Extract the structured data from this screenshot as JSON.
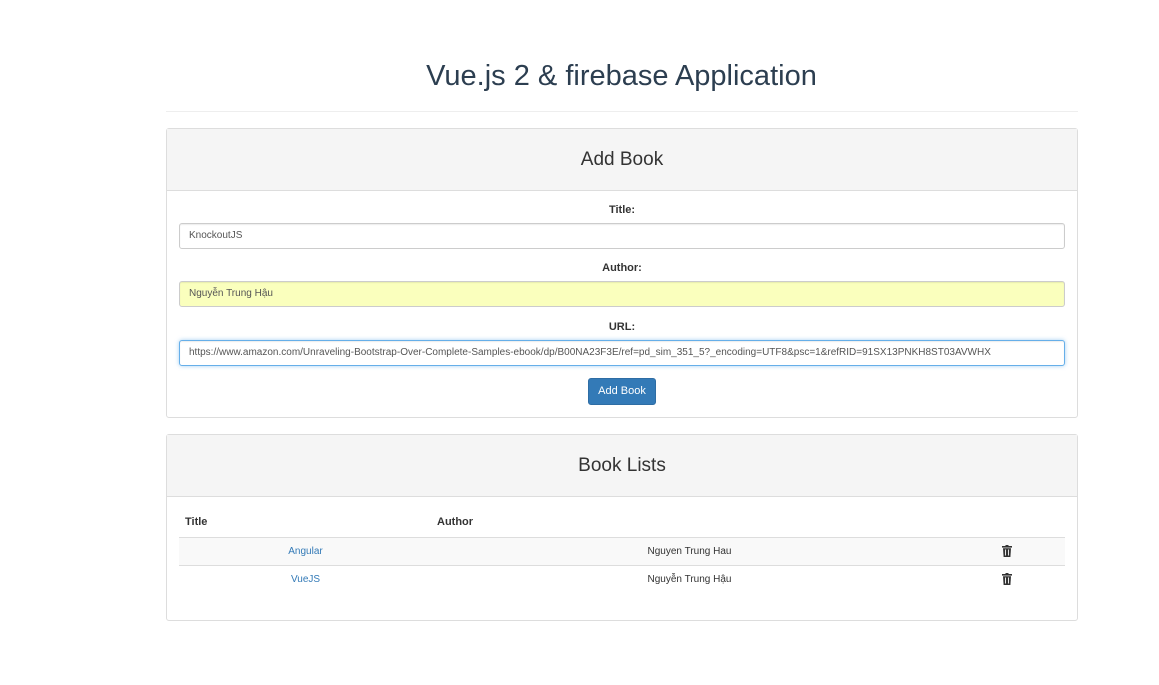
{
  "app": {
    "title": "Vue.js 2 & firebase Application"
  },
  "add_book": {
    "heading": "Add Book",
    "title_label": "Title:",
    "title_value": "KnockoutJS",
    "author_label": "Author:",
    "author_value": "Nguyễn Trung Hậu",
    "url_label": "URL:",
    "url_value": "https://www.amazon.com/Unraveling-Bootstrap-Over-Complete-Samples-ebook/dp/B00NA23F3E/ref=pd_sim_351_5?_encoding=UTF8&psc=1&refRID=91SX13PNKH8ST03AVWHX",
    "button_label": "Add Book"
  },
  "book_list": {
    "heading": "Book Lists",
    "columns": [
      "Title",
      "Author"
    ],
    "rows": [
      {
        "title": "Angular",
        "author": "Nguyen Trung Hau"
      },
      {
        "title": "VueJS",
        "author": "Nguyễn Trung Hậu"
      }
    ],
    "delete_icon": "trash-icon"
  },
  "colors": {
    "primary": "#337ab7",
    "autofill": "#faffbd",
    "heading_bg": "#f5f5f5"
  }
}
